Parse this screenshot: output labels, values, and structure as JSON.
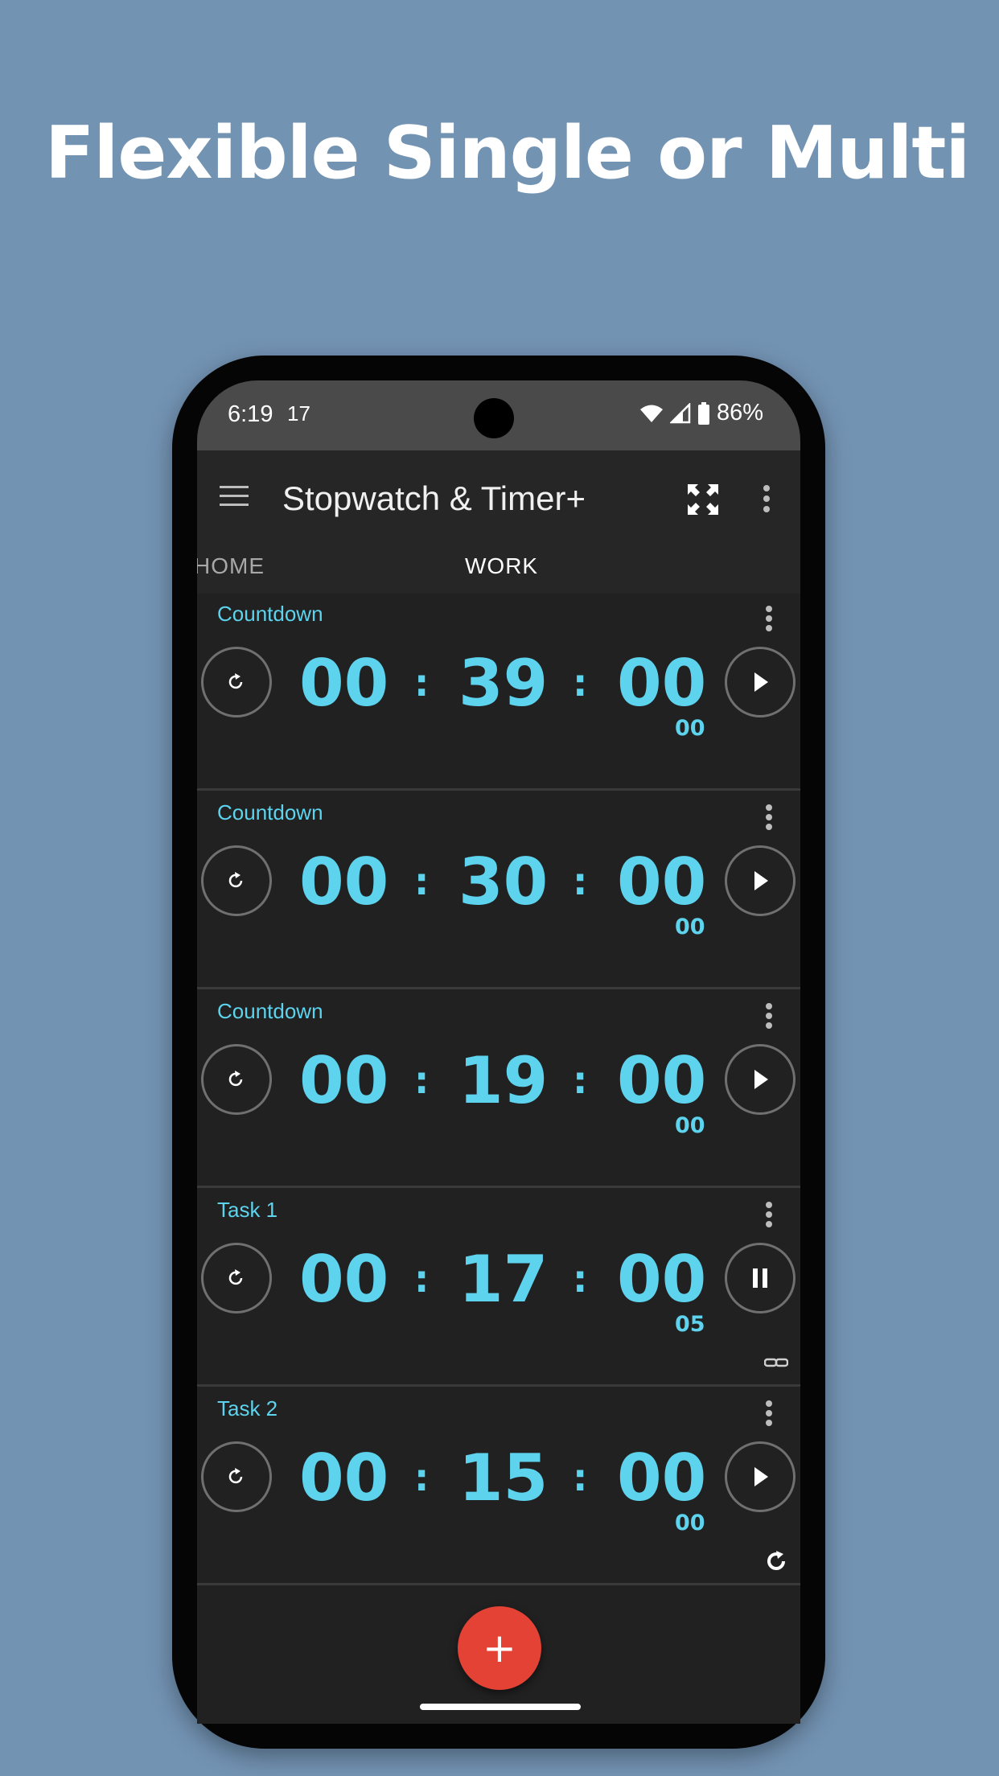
{
  "headline": "Flexible Single or Multi",
  "status_bar": {
    "time": "6:19",
    "calendar_badge": "17",
    "battery": "86%"
  },
  "app_bar": {
    "menu_icon": "hamburger-icon",
    "title": "Stopwatch & Timer+",
    "fullscreen_icon": "fullscreen-icon",
    "overflow_icon": "more-vert-icon"
  },
  "tabs": [
    {
      "label": "HOME",
      "selected": false
    },
    {
      "label": "WORK",
      "selected": true
    }
  ],
  "timers": [
    {
      "label": "Countdown",
      "hours": "00",
      "minutes": "39",
      "seconds": "00",
      "hundredths": "00",
      "state": "stopped",
      "extra_icon": ""
    },
    {
      "label": "Countdown",
      "hours": "00",
      "minutes": "30",
      "seconds": "00",
      "hundredths": "00",
      "state": "stopped",
      "extra_icon": ""
    },
    {
      "label": "Countdown",
      "hours": "00",
      "minutes": "19",
      "seconds": "00",
      "hundredths": "00",
      "state": "stopped",
      "extra_icon": ""
    },
    {
      "label": "Task 1",
      "hours": "00",
      "minutes": "17",
      "seconds": "00",
      "hundredths": "05",
      "state": "running",
      "extra_icon": "link-icon"
    },
    {
      "label": "Task 2",
      "hours": "00",
      "minutes": "15",
      "seconds": "00",
      "hundredths": "00",
      "state": "stopped",
      "extra_icon": "repeat-icon"
    }
  ],
  "separator": ":",
  "fab": {
    "label": "+",
    "icon": "add-icon"
  },
  "colors": {
    "background": "#7393b3",
    "accent": "#5dd3ee",
    "fab": "#e34234",
    "surface": "#212121"
  }
}
